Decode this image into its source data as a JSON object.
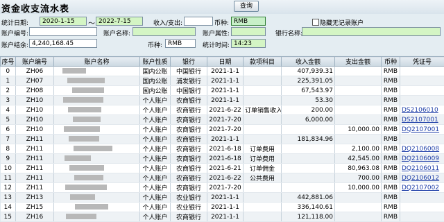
{
  "window": {
    "title": "资金收支流水表"
  },
  "toolbar": {
    "query_label": "查询"
  },
  "filters": {
    "stat_date_label": "统计日期:",
    "date_from": "2020-1-15",
    "date_sep": "～",
    "date_to": "2022-7-15",
    "in_out_label": "收入/支出:",
    "in_out_value": "",
    "currency_label": "币种:",
    "currency_value": "RMB",
    "hide_no_record_label": "隐藏无记录账户",
    "account_no_label": "账户编号:",
    "account_no_value": "",
    "account_name_label": "账户名称:",
    "account_name_value": "",
    "account_attr_label": "账户属性:",
    "account_attr_value": "",
    "bank_name_label": "银行名称:",
    "bank_name_value": "",
    "balance_label": "账户结余:",
    "balance_value": "4,240,168.45",
    "currency2_label": "币种:",
    "currency2_value": "RMB",
    "stat_time_label": "统计时间:",
    "stat_time_value": "14:23"
  },
  "table": {
    "columns": [
      "序号",
      "账户编号",
      "账户名称",
      "账户性质",
      "银行",
      "日期",
      "款项科目",
      "收入金额",
      "支出金额",
      "币种",
      "凭证号"
    ],
    "rows": [
      [
        "0",
        "ZH06",
        "",
        "国内公账",
        "中国银行",
        "2021-1-1",
        "",
        "407,939.31",
        "",
        "RMB",
        ""
      ],
      [
        "1",
        "ZH07",
        "",
        "国内公账",
        "浦发银行",
        "2021-1-1",
        "",
        "225,391.05",
        "",
        "RMB",
        ""
      ],
      [
        "2",
        "ZH08",
        "",
        "国内公账",
        "中国银行",
        "2021-1-1",
        "",
        "67,543.97",
        "",
        "RMB",
        ""
      ],
      [
        "3",
        "ZH10",
        "",
        "个人账户",
        "农商银行",
        "2021-1-1",
        "",
        "53.30",
        "",
        "RMB",
        ""
      ],
      [
        "4",
        "ZH10",
        "",
        "个人账户",
        "农商银行",
        "2021-6-22",
        "订单销售收入",
        "200.00",
        "",
        "RMB",
        "DS2106010"
      ],
      [
        "5",
        "ZH10",
        "",
        "个人账户",
        "农商银行",
        "2021-7-20",
        "",
        "6,000.00",
        "",
        "RMB",
        "DS2107001"
      ],
      [
        "6",
        "ZH10",
        "",
        "个人账户",
        "农商银行",
        "2021-7-20",
        "",
        "",
        "10,000.00",
        "RMB",
        "DQ2107001"
      ],
      [
        "7",
        "ZH11",
        "",
        "个人账户",
        "农商银行",
        "2021-1-1",
        "",
        "181,834.96",
        "",
        "RMB",
        ""
      ],
      [
        "8",
        "ZH11",
        "",
        "个人账户",
        "农商银行",
        "2021-6-18",
        "订单费用",
        "",
        "2,100.00",
        "RMB",
        "DQ2106008"
      ],
      [
        "9",
        "ZH11",
        "",
        "个人账户",
        "农商银行",
        "2021-6-18",
        "订单费用",
        "",
        "42,545.00",
        "RMB",
        "DQ2106009"
      ],
      [
        "10",
        "ZH11",
        "",
        "个人账户",
        "农商银行",
        "2021-6-21",
        "订单佣金",
        "",
        "80,963.08",
        "RMB",
        "DQ2106011"
      ],
      [
        "11",
        "ZH11",
        "",
        "个人账户",
        "农商银行",
        "2021-6-22",
        "公共费用",
        "",
        "700.00",
        "RMB",
        "DQ2106012"
      ],
      [
        "12",
        "ZH11",
        "",
        "个人账户",
        "农商银行",
        "2021-7-20",
        "",
        "",
        "10,000.00",
        "RMB",
        "DQ2107002"
      ],
      [
        "13",
        "ZH13",
        "",
        "个人账户",
        "农业银行",
        "2021-1-1",
        "",
        "442,881.06",
        "",
        "RMB",
        ""
      ],
      [
        "14",
        "ZH15",
        "",
        "个人账户",
        "农业银行",
        "2021-1-1",
        "",
        "336,140.61",
        "",
        "RMB",
        ""
      ],
      [
        "15",
        "ZH16",
        "",
        "个人账户",
        "农商银行",
        "2021-1-1",
        "",
        "121,118.00",
        "",
        "RMB",
        ""
      ]
    ]
  }
}
